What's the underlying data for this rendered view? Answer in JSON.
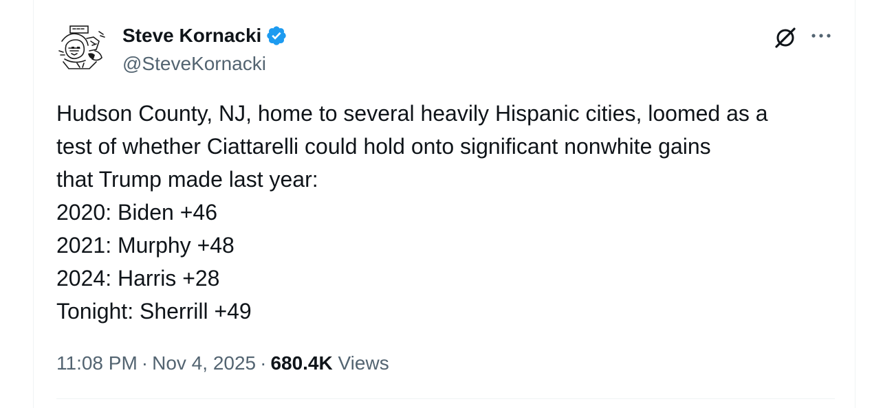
{
  "author": {
    "display_name": "Steve Kornacki",
    "handle": "@SteveKornacki",
    "verified_icon": "verified-badge-icon",
    "avatar_icon": "sketch-avatar"
  },
  "header_actions": {
    "grok_icon": "grok-icon",
    "more_icon": "more-icon"
  },
  "tweet": {
    "lines": [
      "Hudson County, NJ, home to several heavily Hispanic cities, loomed as a",
      "test of whether Ciattarelli could hold onto significant nonwhite gains",
      "that Trump made last year:",
      "2020: Biden +46",
      "2021: Murphy +48",
      "2024: Harris +28",
      "Tonight: Sherrill +49"
    ]
  },
  "meta": {
    "time": "11:08 PM",
    "separator": "·",
    "date": "Nov 4, 2025",
    "views_count": "680.4K",
    "views_label": "Views"
  },
  "colors": {
    "text": "#0f1419",
    "secondary": "#536471",
    "verified": "#1d9bf0",
    "border": "#eff3f4"
  }
}
